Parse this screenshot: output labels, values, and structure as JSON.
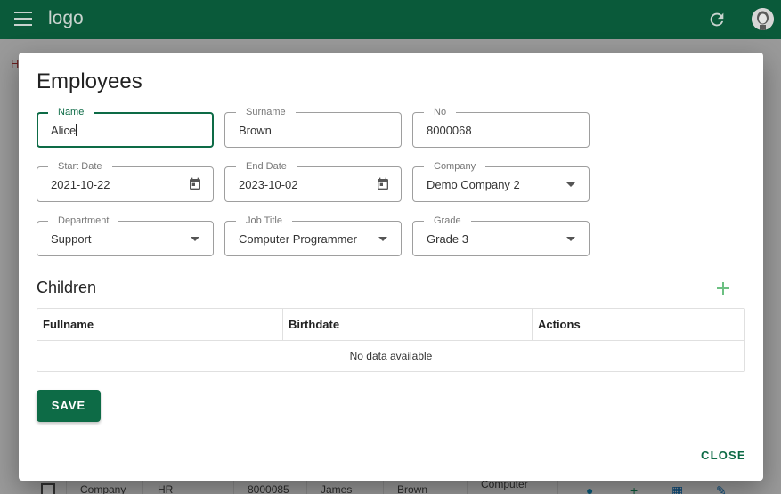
{
  "appbar": {
    "logo": "logo",
    "menu_icon": "menu-icon",
    "refresh_icon": "refresh-icon",
    "avatar_icon": "account-avatar-icon",
    "color": "#0a5a3a"
  },
  "background": {
    "breadcrumb": "H",
    "row": {
      "company": "Company",
      "department": "HR",
      "no": "8000085",
      "name": "James",
      "surname": "Brown",
      "job": "Computer"
    }
  },
  "dialog": {
    "title": "Employees",
    "fields": {
      "name": {
        "label": "Name",
        "value": "Alice"
      },
      "surname": {
        "label": "Surname",
        "value": "Brown"
      },
      "no": {
        "label": "No",
        "value": "8000068"
      },
      "start_date": {
        "label": "Start Date",
        "value": "2021-10-22"
      },
      "end_date": {
        "label": "End Date",
        "value": "2023-10-02"
      },
      "company": {
        "label": "Company",
        "value": "Demo Company 2"
      },
      "department": {
        "label": "Department",
        "value": "Support"
      },
      "job_title": {
        "label": "Job Title",
        "value": "Computer Programmer"
      },
      "grade": {
        "label": "Grade",
        "value": "Grade 3"
      }
    },
    "children": {
      "title": "Children",
      "columns": [
        "Fullname",
        "Birthdate",
        "Actions"
      ],
      "empty_text": "No data available"
    },
    "save_label": "SAVE",
    "close_label": "CLOSE",
    "accent": "#0d6b46"
  }
}
